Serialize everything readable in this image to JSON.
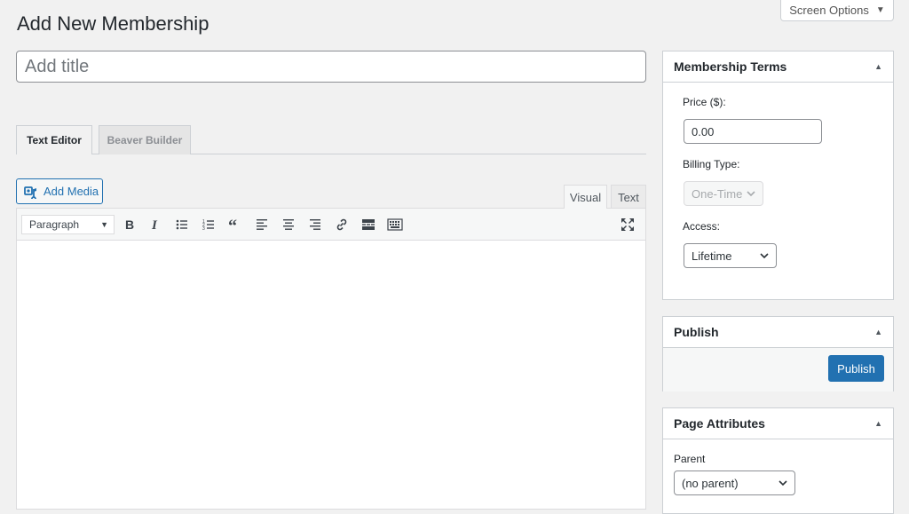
{
  "screen_options": {
    "label": "Screen Options"
  },
  "page": {
    "title": "Add New Membership"
  },
  "title_field": {
    "placeholder": "Add title",
    "value": ""
  },
  "builder_tabs": [
    {
      "label": "Text Editor",
      "active": true
    },
    {
      "label": "Beaver Builder",
      "active": false
    }
  ],
  "editor": {
    "add_media_label": "Add Media",
    "mode_tabs": {
      "visual": "Visual",
      "text": "Text"
    },
    "format_select": "Paragraph",
    "toolbar_icons": [
      "bold-icon",
      "italic-icon",
      "bulleted-list-icon",
      "numbered-list-icon",
      "blockquote-icon",
      "align-left-icon",
      "align-center-icon",
      "align-right-icon",
      "insert-link-icon",
      "read-more-icon",
      "toolbar-toggle-icon",
      "fullscreen-icon"
    ]
  },
  "membership_terms": {
    "title": "Membership Terms",
    "price_label": "Price ($):",
    "price_value": "0.00",
    "billing_label": "Billing Type:",
    "billing_value": "One-Time",
    "access_label": "Access:",
    "access_value": "Lifetime"
  },
  "publish_box": {
    "title": "Publish",
    "button_label": "Publish"
  },
  "page_attributes": {
    "title": "Page Attributes",
    "parent_label": "Parent",
    "parent_value": "(no parent)"
  },
  "colors": {
    "accent": "#2271b1",
    "background": "#f1f1f1",
    "border": "#ccd0d4"
  }
}
